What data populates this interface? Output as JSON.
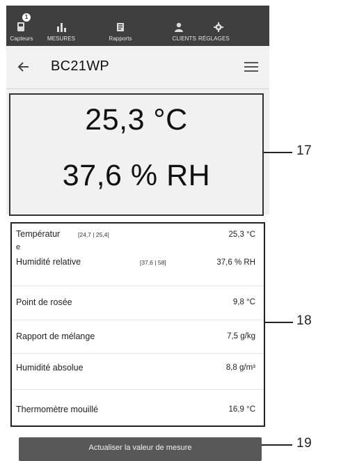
{
  "nav": {
    "items": [
      {
        "label": "Capteurs",
        "icon": "sensor-icon",
        "badge": "1"
      },
      {
        "label": "MESURES",
        "icon": "bar-chart-icon"
      },
      {
        "label": "Rapports",
        "icon": "report-icon"
      },
      {
        "label": "CLIENTS",
        "icon": "user-icon"
      },
      {
        "label": "RÉGLAGES",
        "icon": "gear-icon"
      }
    ],
    "background": "#3f3f3f"
  },
  "header": {
    "title": "BC21WP",
    "back_icon": "arrow-left-icon",
    "menu_icon": "hamburger-menu-icon"
  },
  "display": {
    "temperature": "25,3 °C",
    "humidity": "37,6 % RH"
  },
  "measurements": [
    {
      "label": "Températur",
      "label_wrap": "e",
      "range": "[24,7 | 25,4]",
      "value": "25,3 °C"
    },
    {
      "label": "Humidité relative",
      "range": "[37,6 | 58]",
      "value": "37,6 % RH"
    },
    {
      "label": "Point de rosée",
      "value": "9,8 °C"
    },
    {
      "label": "Rapport de mélange",
      "value": "7,5 g/kg"
    },
    {
      "label": "Humidité absolue",
      "value": "8,8 g/m³"
    },
    {
      "label": "Thermomètre mouillé",
      "value": "16,9 °C"
    }
  ],
  "refresh_button": {
    "label": "Actualiser la valeur de mesure"
  },
  "callouts": [
    "17",
    "18",
    "19"
  ]
}
